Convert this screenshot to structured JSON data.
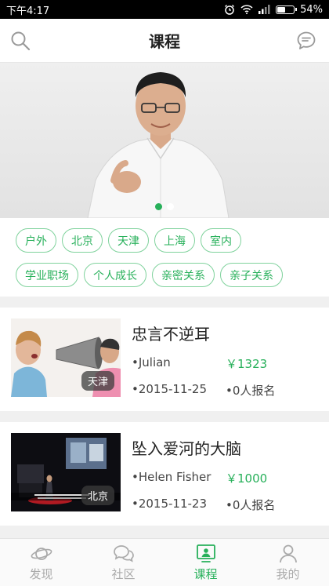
{
  "status_bar": {
    "time": "下午4:17",
    "battery": "54%",
    "battery_level": 0.54
  },
  "nav": {
    "title": "课程"
  },
  "banner": {
    "active_slide": 1,
    "total_slides": 2
  },
  "tags": {
    "row1": [
      "户外",
      "北京",
      "天津",
      "上海",
      "室内"
    ],
    "row2": [
      "学业职场",
      "个人成长",
      "亲密关系",
      "亲子关系"
    ]
  },
  "courses": [
    {
      "title": "忠言不逆耳",
      "teacher": "•Julian",
      "price": "￥1323",
      "date": "•2015-11-25",
      "enrolled": "•0人报名",
      "city": "天津"
    },
    {
      "title": "坠入爱河的大脑",
      "teacher": "•Helen Fisher",
      "price": "￥1000",
      "date": "•2015-11-23",
      "enrolled": "•0人报名",
      "city": "北京"
    }
  ],
  "tabbar": {
    "items": [
      "发现",
      "社区",
      "课程",
      "我的"
    ],
    "active": "课程"
  },
  "colors": {
    "accent": "#27b05a",
    "tag_border": "#7fd29c"
  }
}
